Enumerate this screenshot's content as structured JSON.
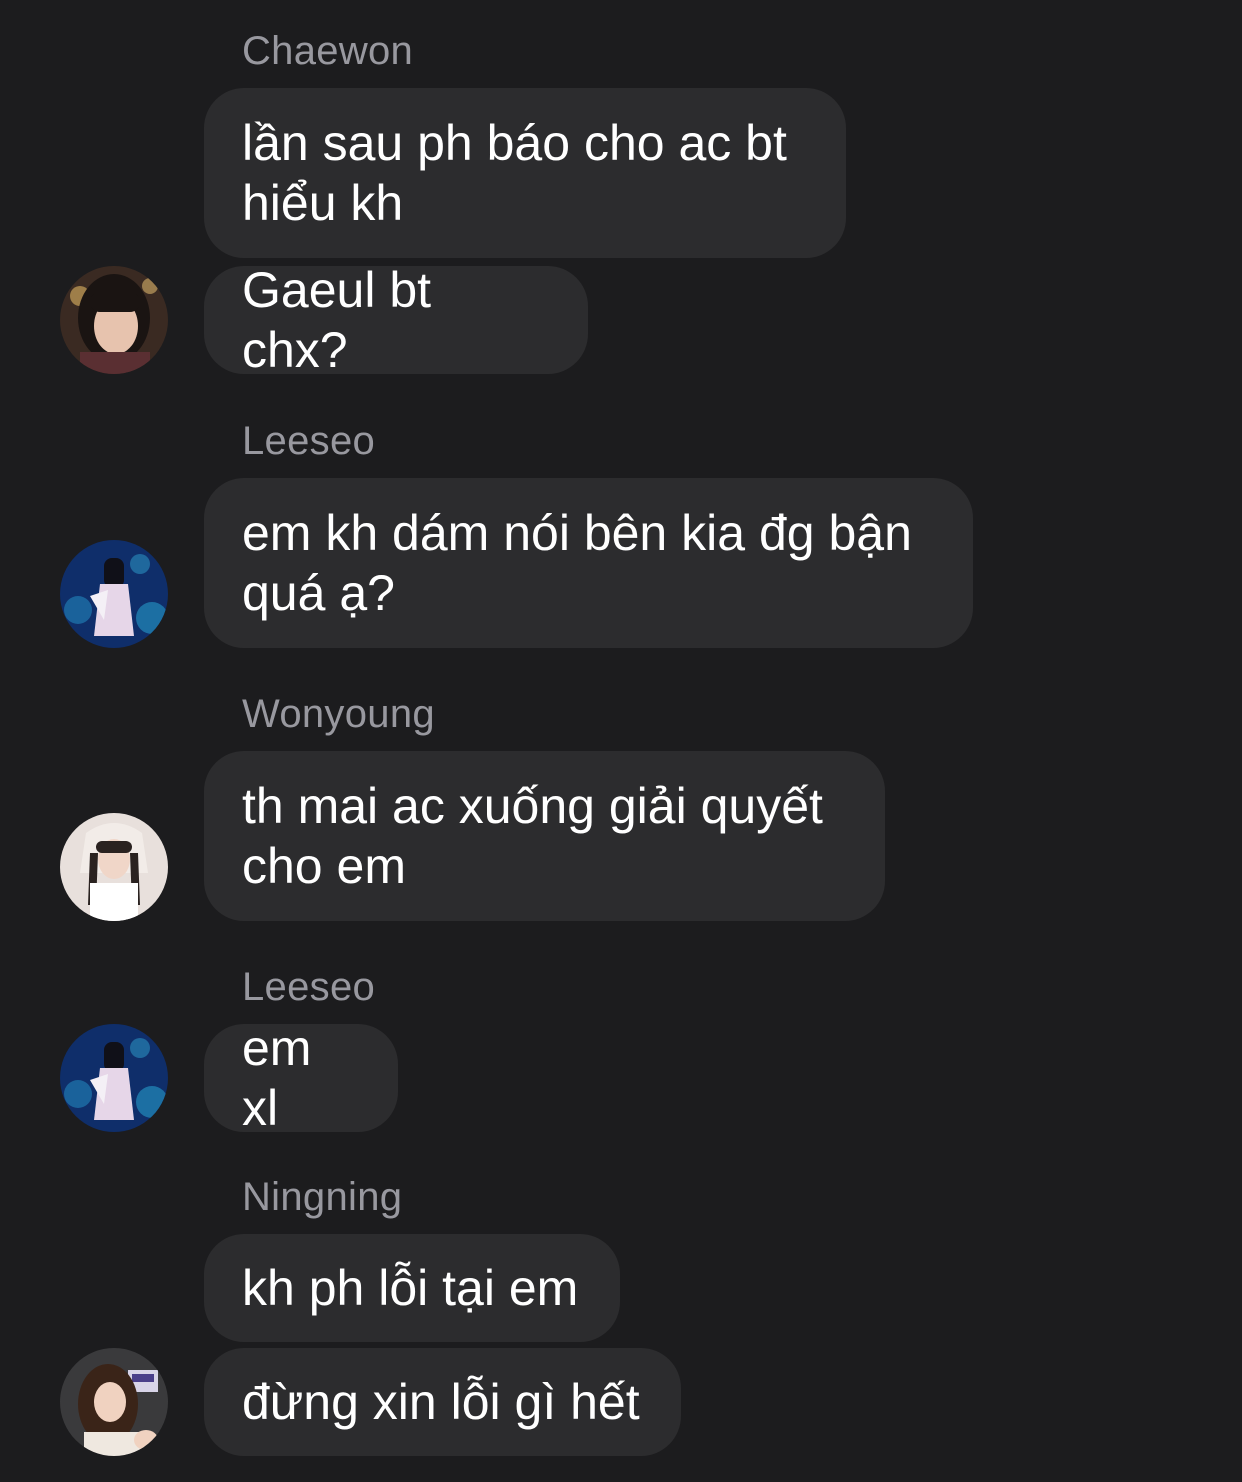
{
  "conversation": {
    "groups": [
      {
        "sender": "Chaewon",
        "avatar": "chaewon-avatar",
        "messages": [
          "lần sau ph báo cho ac bt hiểu kh",
          "Gaeul bt chx?"
        ]
      },
      {
        "sender": "Leeseo",
        "avatar": "leeseo-avatar",
        "messages": [
          "em kh dám nói bên kia đg bận quá ạ?"
        ]
      },
      {
        "sender": "Wonyoung",
        "avatar": "wonyoung-avatar",
        "messages": [
          "th mai ac xuống giải quyết cho em"
        ]
      },
      {
        "sender": "Leeseo",
        "avatar": "leeseo-avatar",
        "messages": [
          "em xl"
        ]
      },
      {
        "sender": "Ningning",
        "avatar": "ningning-avatar",
        "messages": [
          "kh ph lỗi tại em",
          "đừng xin lỗi gì hết"
        ]
      }
    ]
  },
  "colors": {
    "background": "#1c1c1e",
    "bubble": "#2c2c2e",
    "sender_name": "#98989f",
    "message_text": "#ffffff"
  }
}
